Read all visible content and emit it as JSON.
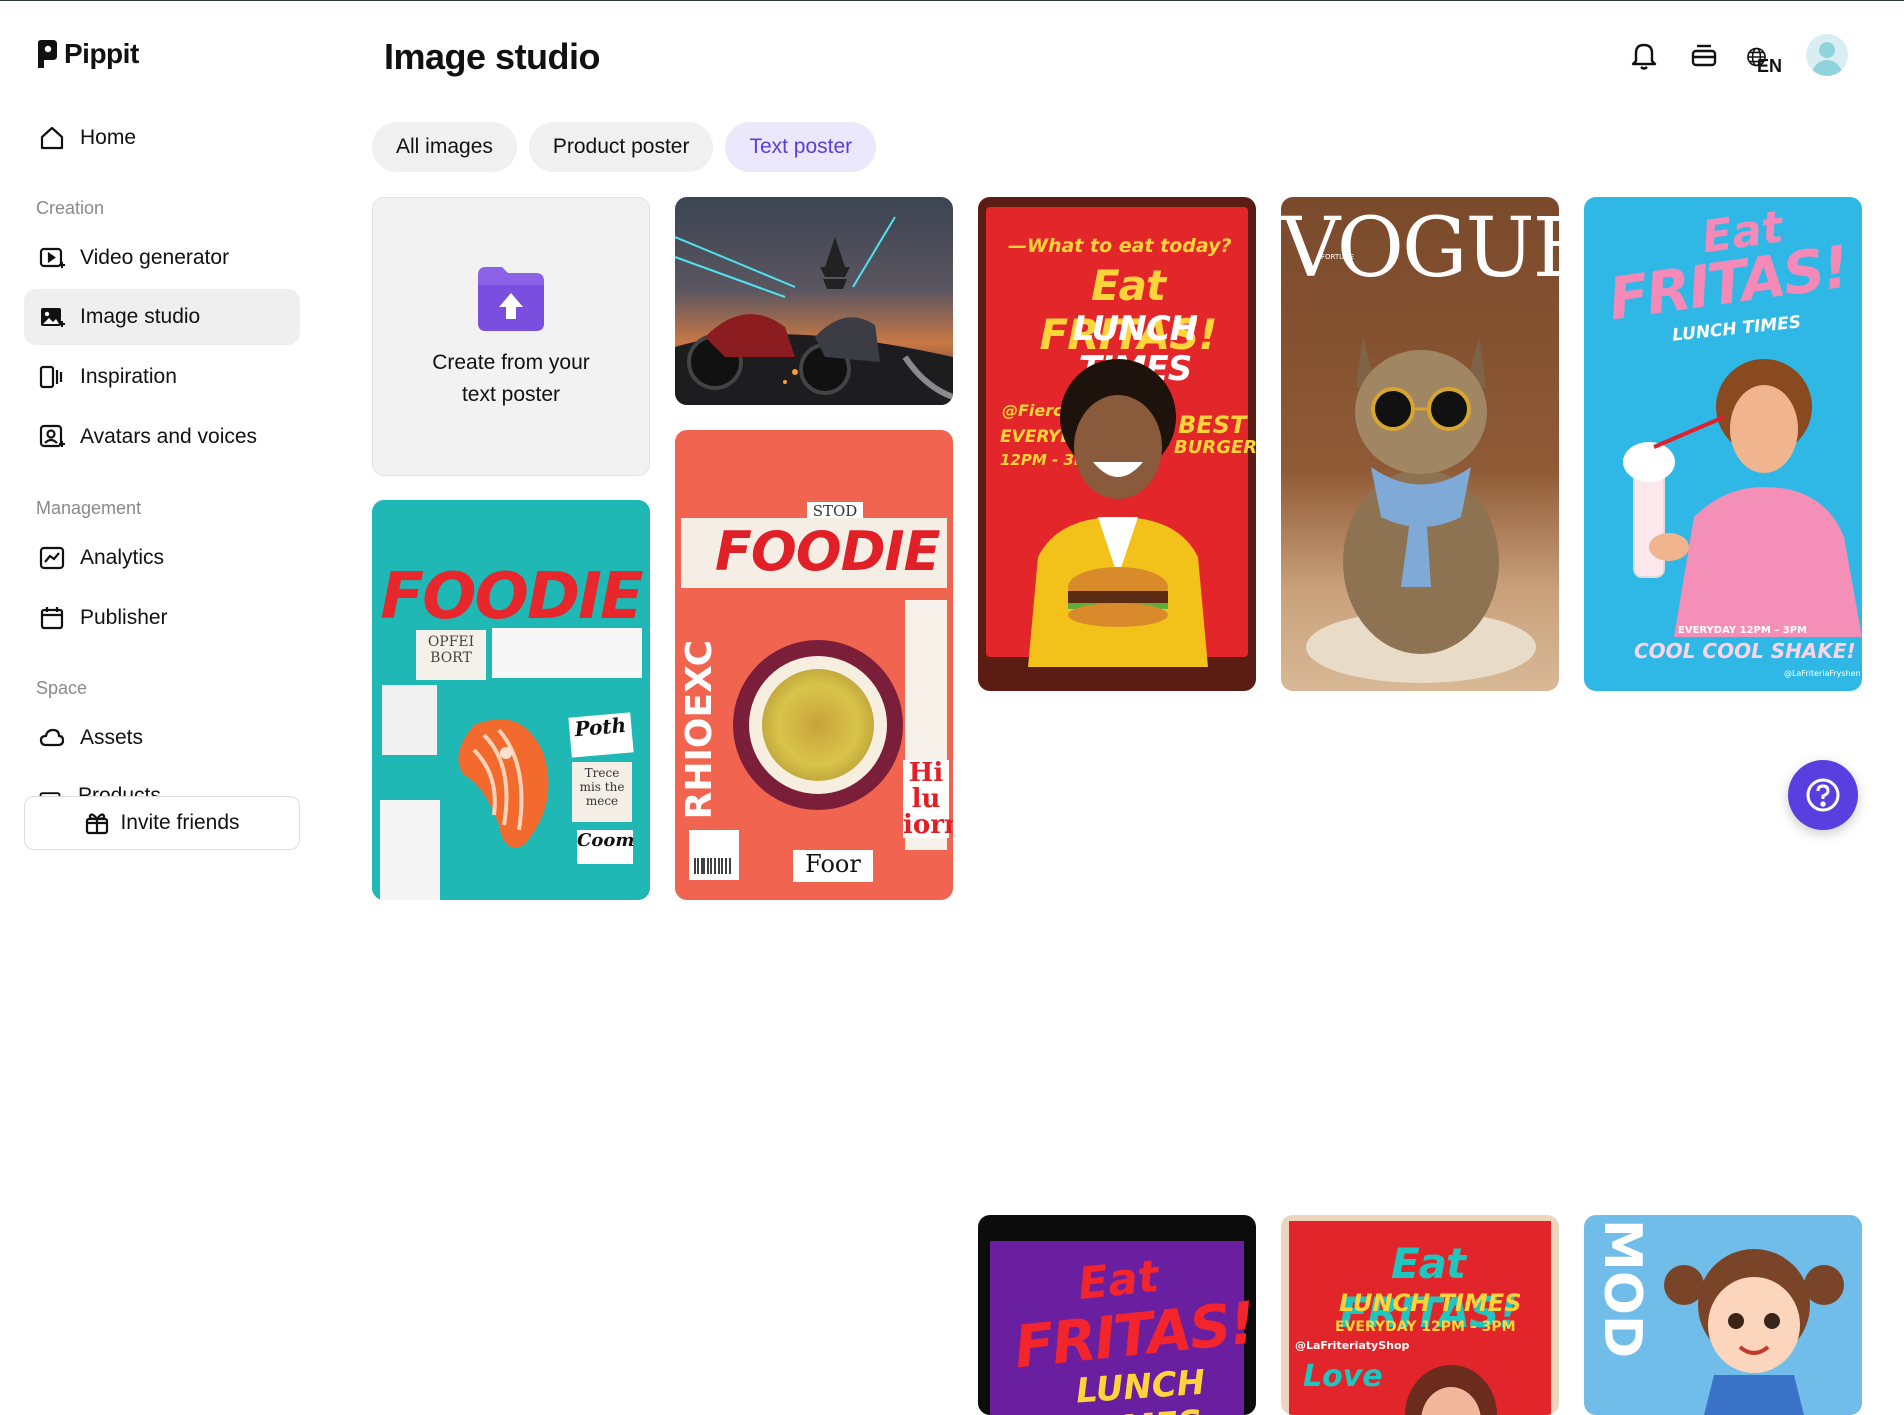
{
  "app": {
    "name": "Pippit"
  },
  "sidebar": {
    "home": "Home",
    "sections": [
      {
        "label": "Creation",
        "items": [
          "Video generator",
          "Image studio",
          "Inspiration",
          "Avatars and voices"
        ]
      },
      {
        "label": "Management",
        "items": [
          "Analytics",
          "Publisher"
        ]
      },
      {
        "label": "Space",
        "items": [
          "Assets",
          "Products"
        ]
      }
    ],
    "active_item": "Image studio",
    "invite_label": "Invite friends"
  },
  "header": {
    "title": "Image studio",
    "language": "EN",
    "icons": [
      "bell-icon",
      "credits-icon",
      "globe-icon",
      "avatar"
    ]
  },
  "tabs": [
    {
      "label": "All images",
      "active": false
    },
    {
      "label": "Product poster",
      "active": false
    },
    {
      "label": "Text poster",
      "active": true
    }
  ],
  "upload_card": {
    "label_line1": "Create from your",
    "label_line2": "text poster"
  },
  "posters": {
    "foodie_teal": {
      "title": "FOODIE",
      "words": [
        "OPFEI",
        "BORT",
        "Poth",
        "Trece mis the mece",
        "Coom"
      ]
    },
    "foodie_coral": {
      "title": "FOODIE",
      "side_text": "RHIOEXC",
      "top_text": "STOD",
      "bottom_text": "Foor",
      "accent_text": "Hi lu iorn"
    },
    "fritas_red": {
      "kicker": "—What to eat today?",
      "title": "Eat FRITAS!",
      "subtitle": "LUNCH TIMES",
      "handle": "@Fierce!",
      "hours_line1": "EVERYDAY",
      "hours_line2": "12PM - 3PM",
      "badge_line1": "BEST",
      "badge_line2": "BURGER!"
    },
    "fritas_purple": {
      "line1": "Eat",
      "line2": "FRITAS!",
      "line3": "LUNCH TIMES"
    },
    "vogue": {
      "masthead": "VOGUE",
      "tiny": "FORTUNE"
    },
    "fritas_teal": {
      "title": "Eat FRITAS!",
      "subtitle": "LUNCH TIMES",
      "hours": "EVERYDAY 12PM – 3PM",
      "handle": "@LaFriteriatyShop",
      "footer": "Love"
    },
    "fritas_blue": {
      "line1": "Eat",
      "line2": "FRITAS!",
      "subtitle": "LUNCH TIMES",
      "hours": "EVERYDAY 12PM – 3PM",
      "tagline": "COOL COOL SHAKE!",
      "handle": "@LaFriteriaFryshen"
    },
    "mod_blue": {
      "side_text": "MOD"
    }
  },
  "colors": {
    "accent": "#5b3ddb",
    "help_button": "#5a3fe0"
  }
}
